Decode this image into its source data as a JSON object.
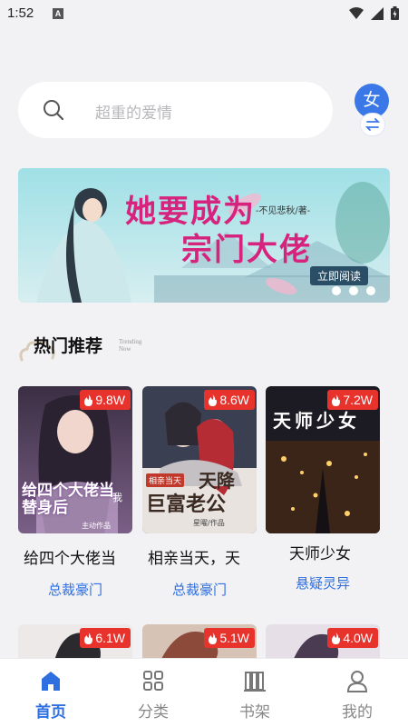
{
  "status": {
    "time": "1:52",
    "a_label": "A"
  },
  "search": {
    "placeholder": "超重的爱情"
  },
  "gender": {
    "label": "女"
  },
  "banner": {
    "title_line1": "她要成为",
    "title_line2": "宗门大佬",
    "author": "-不见悲秋/著-",
    "read_button": "立即阅读"
  },
  "section": {
    "title": "热门推荐",
    "subtitle_line1": "Trending",
    "subtitle_line2": "Now"
  },
  "books": [
    {
      "title": "给四个大佬当",
      "tag": "总裁豪门",
      "heat": "9.8W",
      "cover_text1": "给四个大佬当替身后",
      "cover_text2": "我",
      "cover_text3": "主动作品"
    },
    {
      "title": "相亲当天，天",
      "tag": "总裁豪门",
      "heat": "8.6W",
      "cover_text1": "相亲当天",
      "cover_text2": "天降",
      "cover_text3": "巨富老公",
      "cover_text4": "星曜/作品"
    },
    {
      "title": "天师少女",
      "tag": "悬疑灵异",
      "heat": "7.2W",
      "cover_text1": "天师少女"
    }
  ],
  "books_row2": [
    {
      "heat": "6.1W"
    },
    {
      "heat": "5.1W"
    },
    {
      "heat": "4.0W"
    }
  ],
  "tabs": [
    {
      "label": "首页",
      "active": true
    },
    {
      "label": "分类",
      "active": false
    },
    {
      "label": "书架",
      "active": false
    },
    {
      "label": "我的",
      "active": false
    }
  ],
  "colors": {
    "accent": "#2f6fe0",
    "badge": "#e8332d",
    "background": "#f2f2f4"
  }
}
